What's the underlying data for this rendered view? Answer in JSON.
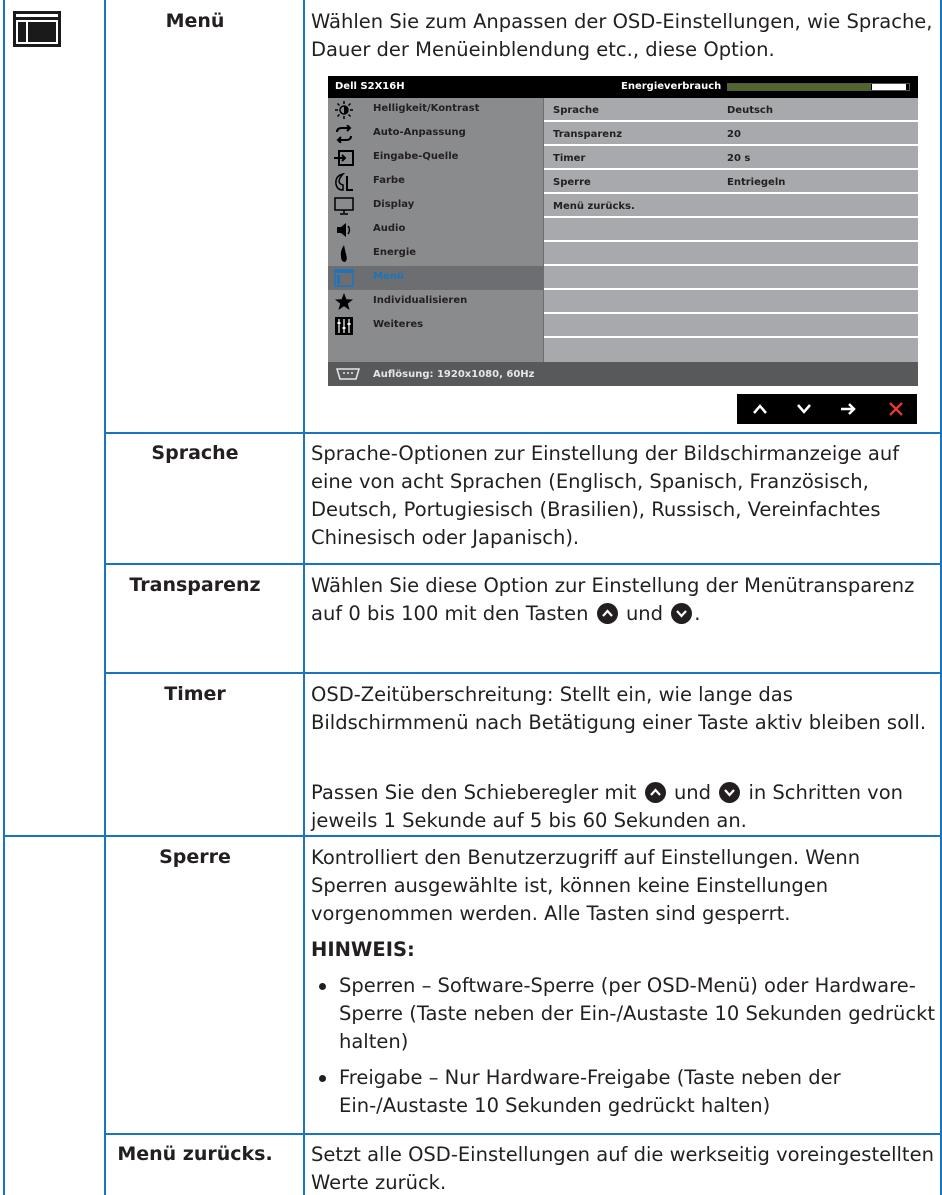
{
  "rows": [
    {
      "label": "Menü",
      "desc": "Wählen Sie zum Anpassen der OSD-Einstellungen, wie Sprache, Dauer der Menüeinblendung etc., diese Option."
    },
    {
      "label": "Sprache",
      "desc": "Sprache-Optionen zur Einstellung der Bildschirmanzeige auf eine von acht Sprachen (Englisch, Spanisch, Französisch, Deutsch, Portugiesisch (Brasilien), Russisch, Vereinfachtes Chinesisch oder Japanisch)."
    },
    {
      "label": "Transparenz",
      "desc_a": "Wählen Sie diese Option zur Einstellung der Menütransparenz auf 0 bis 100 mit den Tasten",
      "desc_b": "und",
      "desc_c": "."
    },
    {
      "label": "Timer",
      "desc": "OSD-Zeitüberschreitung: Stellt ein, wie lange das Bildschirmmenü nach Betätigung einer Taste aktiv bleiben soll.",
      "desc2_a": "Passen Sie den Schieberegler mit",
      "desc2_b": "und",
      "desc2_c": "in Schritten von jeweils 1 Sekunde auf 5 bis 60 Sekunden an."
    },
    {
      "label": "Sperre",
      "desc": "Kontrolliert den Benutzerzugriff auf Einstellungen. Wenn Sperren ausgewählte ist, können keine Einstellungen vorgenommen werden. Alle Tasten sind gesperrt.",
      "note_title": "HINWEIS:",
      "bullets": [
        "Sperren – Software-Sperre (per OSD-Menü) oder Hardware-Sperre (Taste neben der Ein-/Austaste 10 Sekunden gedrückt halten)",
        "Freigabe – Nur Hardware-Freigabe (Taste neben der Ein-/Austaste 10 Sekunden gedrückt halten)"
      ]
    },
    {
      "label": "Menü zurücks.",
      "desc": "Setzt alle OSD-Einstellungen auf die werkseitig voreingestellten Werte zurück."
    }
  ],
  "osd": {
    "model": "Dell S2X16H",
    "energy_label": "Energieverbrauch",
    "energy_level": 0.79,
    "menu_items": [
      {
        "label": "Helligkeit/Kontrast",
        "icon": "brightness-icon"
      },
      {
        "label": "Auto-Anpassung",
        "icon": "auto-adjust-icon"
      },
      {
        "label": "Eingabe-Quelle",
        "icon": "input-source-icon"
      },
      {
        "label": "Farbe",
        "icon": "color-icon"
      },
      {
        "label": "Display",
        "icon": "display-icon"
      },
      {
        "label": "Audio",
        "icon": "audio-icon"
      },
      {
        "label": "Energie",
        "icon": "energy-icon"
      },
      {
        "label": "Menü",
        "icon": "menu-icon",
        "active": true
      },
      {
        "label": "Individualisieren",
        "icon": "star-icon"
      },
      {
        "label": "Weiteres",
        "icon": "others-icon"
      }
    ],
    "settings": [
      {
        "key": "Sprache",
        "value": "Deutsch"
      },
      {
        "key": "Transparenz",
        "value": "20"
      },
      {
        "key": "Timer",
        "value": "20 s"
      },
      {
        "key": "Sperre",
        "value": "Entriegeln"
      },
      {
        "key": "Menü zurücks.",
        "value": ""
      }
    ],
    "resolution": "Auflösung: 1920x1080, 60Hz",
    "colors": {
      "active": "#1b75bc",
      "energy_bar": "#52652c",
      "close": "#e03a2e"
    }
  }
}
